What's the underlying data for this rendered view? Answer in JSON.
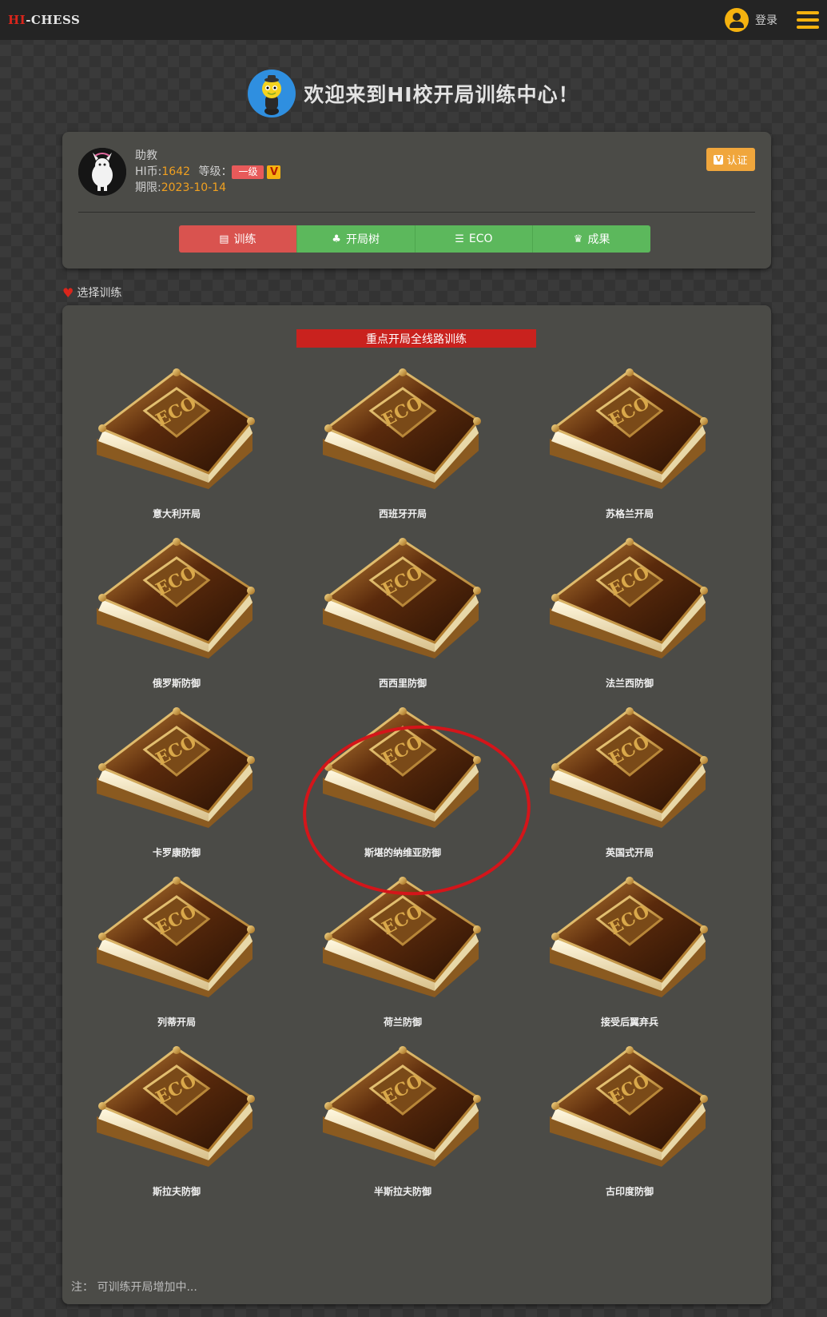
{
  "header": {
    "brand_hi": "HI",
    "brand_rest": "-CHESS",
    "login_label": "登录"
  },
  "welcome": {
    "title": "欢迎来到HI校开局训练中心！"
  },
  "profile": {
    "name": "助教",
    "coins_label": "HI币:",
    "coins_value": "1642",
    "level_label": "等级：",
    "level_value": "一级",
    "v_badge": "V",
    "expiry_label": "期限:",
    "expiry_value": "2023-10-14",
    "verify_label": "认证"
  },
  "tabs": [
    {
      "label": "训练",
      "icon": "book-icon",
      "color": "#d9534f"
    },
    {
      "label": "开局树",
      "icon": "tree-icon",
      "color": "#5cb85c"
    },
    {
      "label": "ECO",
      "icon": "list-icon",
      "color": "#5cb85c"
    },
    {
      "label": "成果",
      "icon": "crown-icon",
      "color": "#5cb85c"
    }
  ],
  "section": {
    "label": "选择训练"
  },
  "training": {
    "banner": "重点开局全线路训练",
    "books": [
      {
        "label": "意大利开局"
      },
      {
        "label": "西班牙开局"
      },
      {
        "label": "苏格兰开局"
      },
      {
        "label": "俄罗斯防御"
      },
      {
        "label": "西西里防御"
      },
      {
        "label": "法兰西防御"
      },
      {
        "label": "卡罗康防御"
      },
      {
        "label": "斯堪的纳维亚防御"
      },
      {
        "label": "英国式开局"
      },
      {
        "label": "列蒂开局"
      },
      {
        "label": "荷兰防御"
      },
      {
        "label": "接受后翼弃兵"
      },
      {
        "label": "斯拉夫防御"
      },
      {
        "label": "半斯拉夫防御"
      },
      {
        "label": "古印度防御"
      }
    ],
    "book_cover_text": "ECO",
    "note": "注： 可训练开局增加中..."
  },
  "colors": {
    "accent_yellow": "#f5b20f",
    "brand_red": "#d9251b",
    "tab_active": "#d9534f",
    "tab_green": "#5cb85c",
    "highlight_circle": "#d4151a"
  }
}
